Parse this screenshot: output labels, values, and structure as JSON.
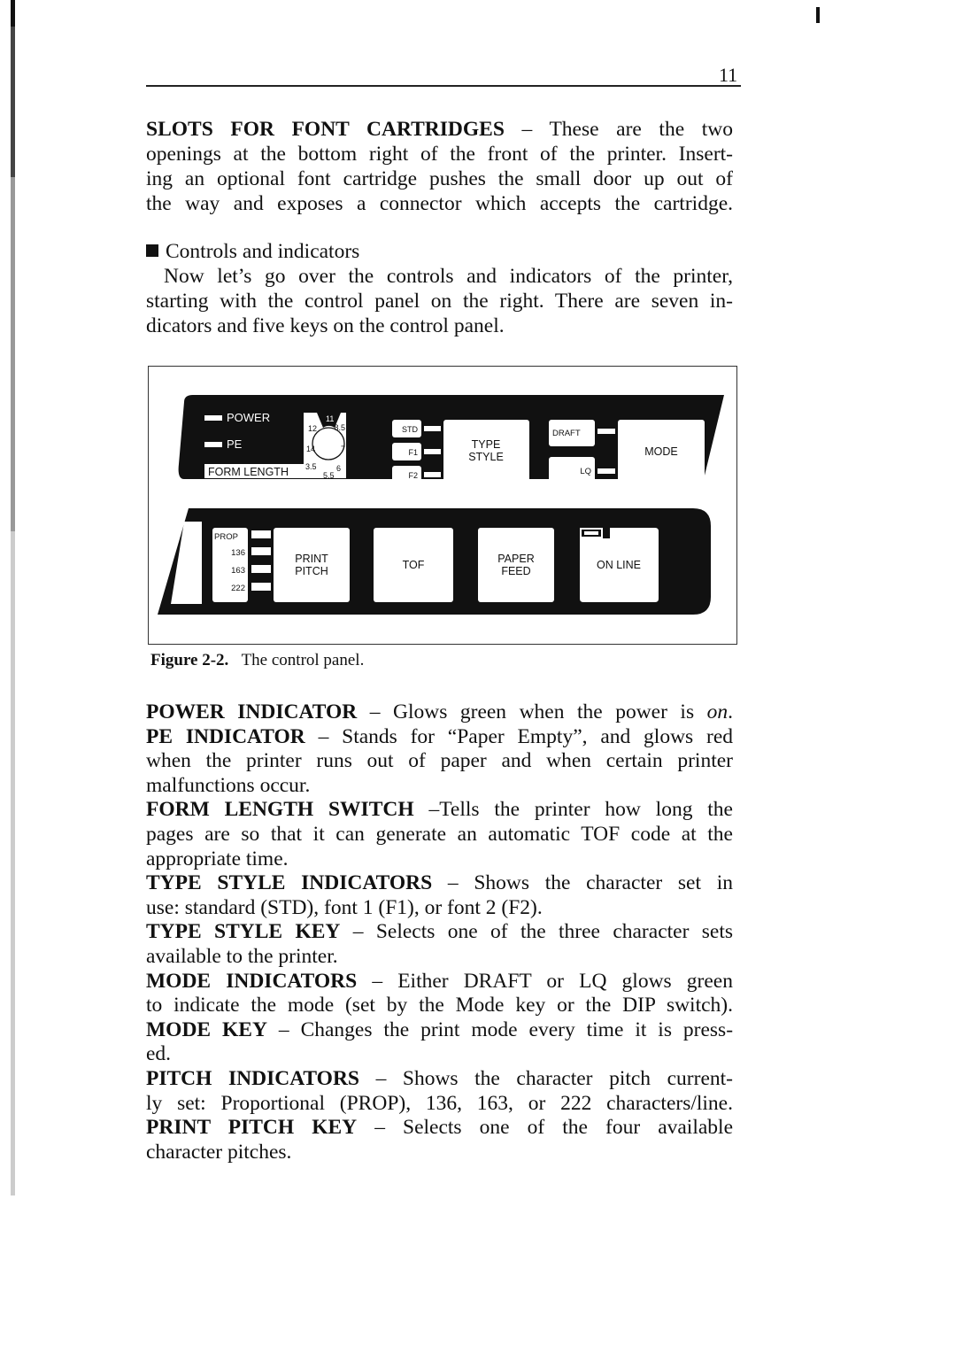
{
  "page": {
    "number": "11"
  },
  "intro": {
    "heading": "SLOTS FOR FONT CARTRIDGES",
    "dash": " – ",
    "body_lines": [
      "These are the two",
      "openings at the bottom right of the front of the printer. Insert-",
      "ing an optional font cartridge pushes the small door up out of",
      "the way and exposes a connector which accepts the cartridge."
    ]
  },
  "section": {
    "title": "Controls and indicators",
    "body_lines": [
      "Now let’s go over the controls and indicators of the printer,",
      "starting with the control panel on the right. There are seven in-",
      "dicators and five keys on the control panel."
    ]
  },
  "figure": {
    "label": "Figure 2-2.",
    "caption": "The control panel.",
    "top_panel": {
      "indicators": [
        "POWER",
        "PE"
      ],
      "form_length_label": "FORM LENGTH",
      "dial_values": [
        "11",
        "8.5",
        "7",
        "6",
        "5.5",
        "3.5",
        "14",
        "12"
      ],
      "type_style_indicators": [
        "STD",
        "F1",
        "F2"
      ],
      "type_style_key": [
        "TYPE",
        "STYLE"
      ],
      "mode_indicators": [
        "DRAFT",
        "LQ"
      ],
      "mode_key": "MODE"
    },
    "bottom_panel": {
      "pitch_indicators": [
        "PROP",
        "136",
        "163",
        "222"
      ],
      "print_pitch_key": [
        "PRINT",
        "PITCH"
      ],
      "tof_key": "TOF",
      "paper_feed_key": [
        "PAPER",
        "FEED"
      ],
      "on_line_key": "ON LINE"
    }
  },
  "descriptions": [
    {
      "term": "POWER INDICATOR",
      "sep": " – ",
      "lines": [
        "Glows green when the power is "
      ],
      "italic_tail": "on",
      "tail": "."
    },
    {
      "term": "PE INDICATOR",
      "sep": " – ",
      "lines": [
        "Stands for “Paper Empty”, and glows red",
        "when the printer runs out of paper and when certain printer",
        "malfunctions occur."
      ]
    },
    {
      "term": "FORM LENGTH SWITCH",
      "sep": " –",
      "lines": [
        "Tells the printer how long the",
        "pages are so that it can generate an automatic TOF code at the",
        "appropriate time."
      ]
    },
    {
      "term": "TYPE STYLE INDICATORS",
      "sep": " – ",
      "lines": [
        "Shows the character set in",
        "use: standard (STD), font 1 (F1), or font 2 (F2)."
      ]
    },
    {
      "term": "TYPE STYLE KEY",
      "sep": " – ",
      "lines": [
        "Selects one of the three character sets",
        "available to the printer."
      ]
    },
    {
      "term": "MODE INDICATORS",
      "sep": " – ",
      "lines": [
        "Either DRAFT or LQ glows green",
        "to indicate the mode (set by the Mode key or the DIP switch)."
      ]
    },
    {
      "term": "MODE KEY",
      "sep": " – ",
      "lines": [
        "Changes the print mode every time it is press-",
        "ed."
      ]
    },
    {
      "term": "PITCH INDICATORS",
      "sep": " – ",
      "lines": [
        "Shows the character pitch current-",
        "ly set: Proportional (PROP), 136, 163, or 222 characters/line."
      ]
    },
    {
      "term": "PRINT PITCH KEY",
      "sep": " – ",
      "lines": [
        "Selects one of the four available",
        "character pitches."
      ]
    }
  ]
}
